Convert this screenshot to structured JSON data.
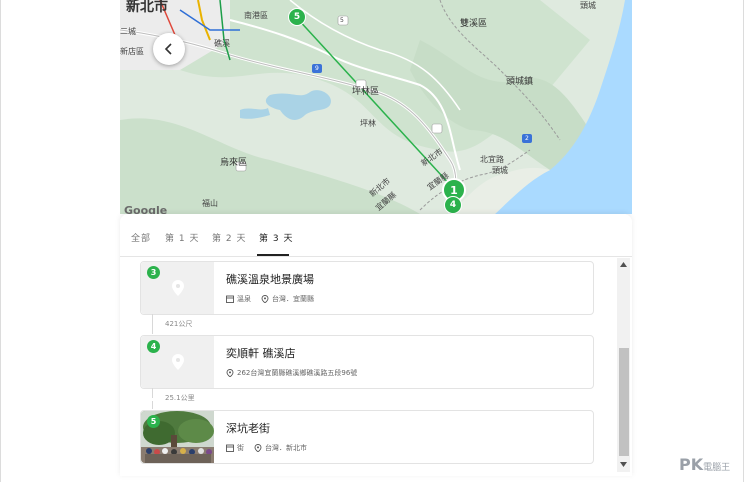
{
  "map": {
    "labels": {
      "new_taipei_city": "新北市",
      "pinglin": "坪林區",
      "shuangxi": "雙溪區",
      "toucheng": "頭城鎮",
      "wulai": "烏來區",
      "new_taipei_border": "新北市",
      "yilan_county": "宜蘭縣",
      "new_taipei_border2": "新北市",
      "yilan_county2": "宜蘭縣",
      "jiaoxi": "頭城",
      "xindian": "新店區",
      "beishi": "北宜路",
      "liyuan": "礁溪",
      "fushan": "福山",
      "nan": "南港區",
      "guangming": "坪林",
      "luo": "二城",
      "route_5": "5",
      "route_9": "9",
      "route_2": "2",
      "mujia": "頭城"
    },
    "google": "Google",
    "markers": [
      "5",
      "1",
      "4"
    ],
    "icons": {
      "back": "chevron-left-icon"
    }
  },
  "tabs": [
    {
      "label": "全部"
    },
    {
      "label": "第 1 天"
    },
    {
      "label": "第 2 天"
    },
    {
      "label": "第 3 天",
      "active": true
    }
  ],
  "places": [
    {
      "number": "3",
      "name": "礁溪溫泉地景廣場",
      "category": "溫泉",
      "location": "台灣．宜蘭縣",
      "has_photo": false
    },
    {
      "distance": "421公尺"
    },
    {
      "number": "4",
      "name": "奕順軒 礁溪店",
      "address": "262台灣宜蘭縣礁溪鄉礁溪路五段96號",
      "has_photo": false
    },
    {
      "distance": "25.1公里"
    },
    {
      "number": "5",
      "name": "深坑老街",
      "category": "街",
      "location": "台灣．新北市",
      "has_photo": true
    }
  ],
  "watermark": {
    "main": "PK",
    "sub": "電腦王"
  },
  "colors": {
    "accent": "#2bb24c",
    "sea": "#aadaff",
    "land": "#dfeadf"
  }
}
